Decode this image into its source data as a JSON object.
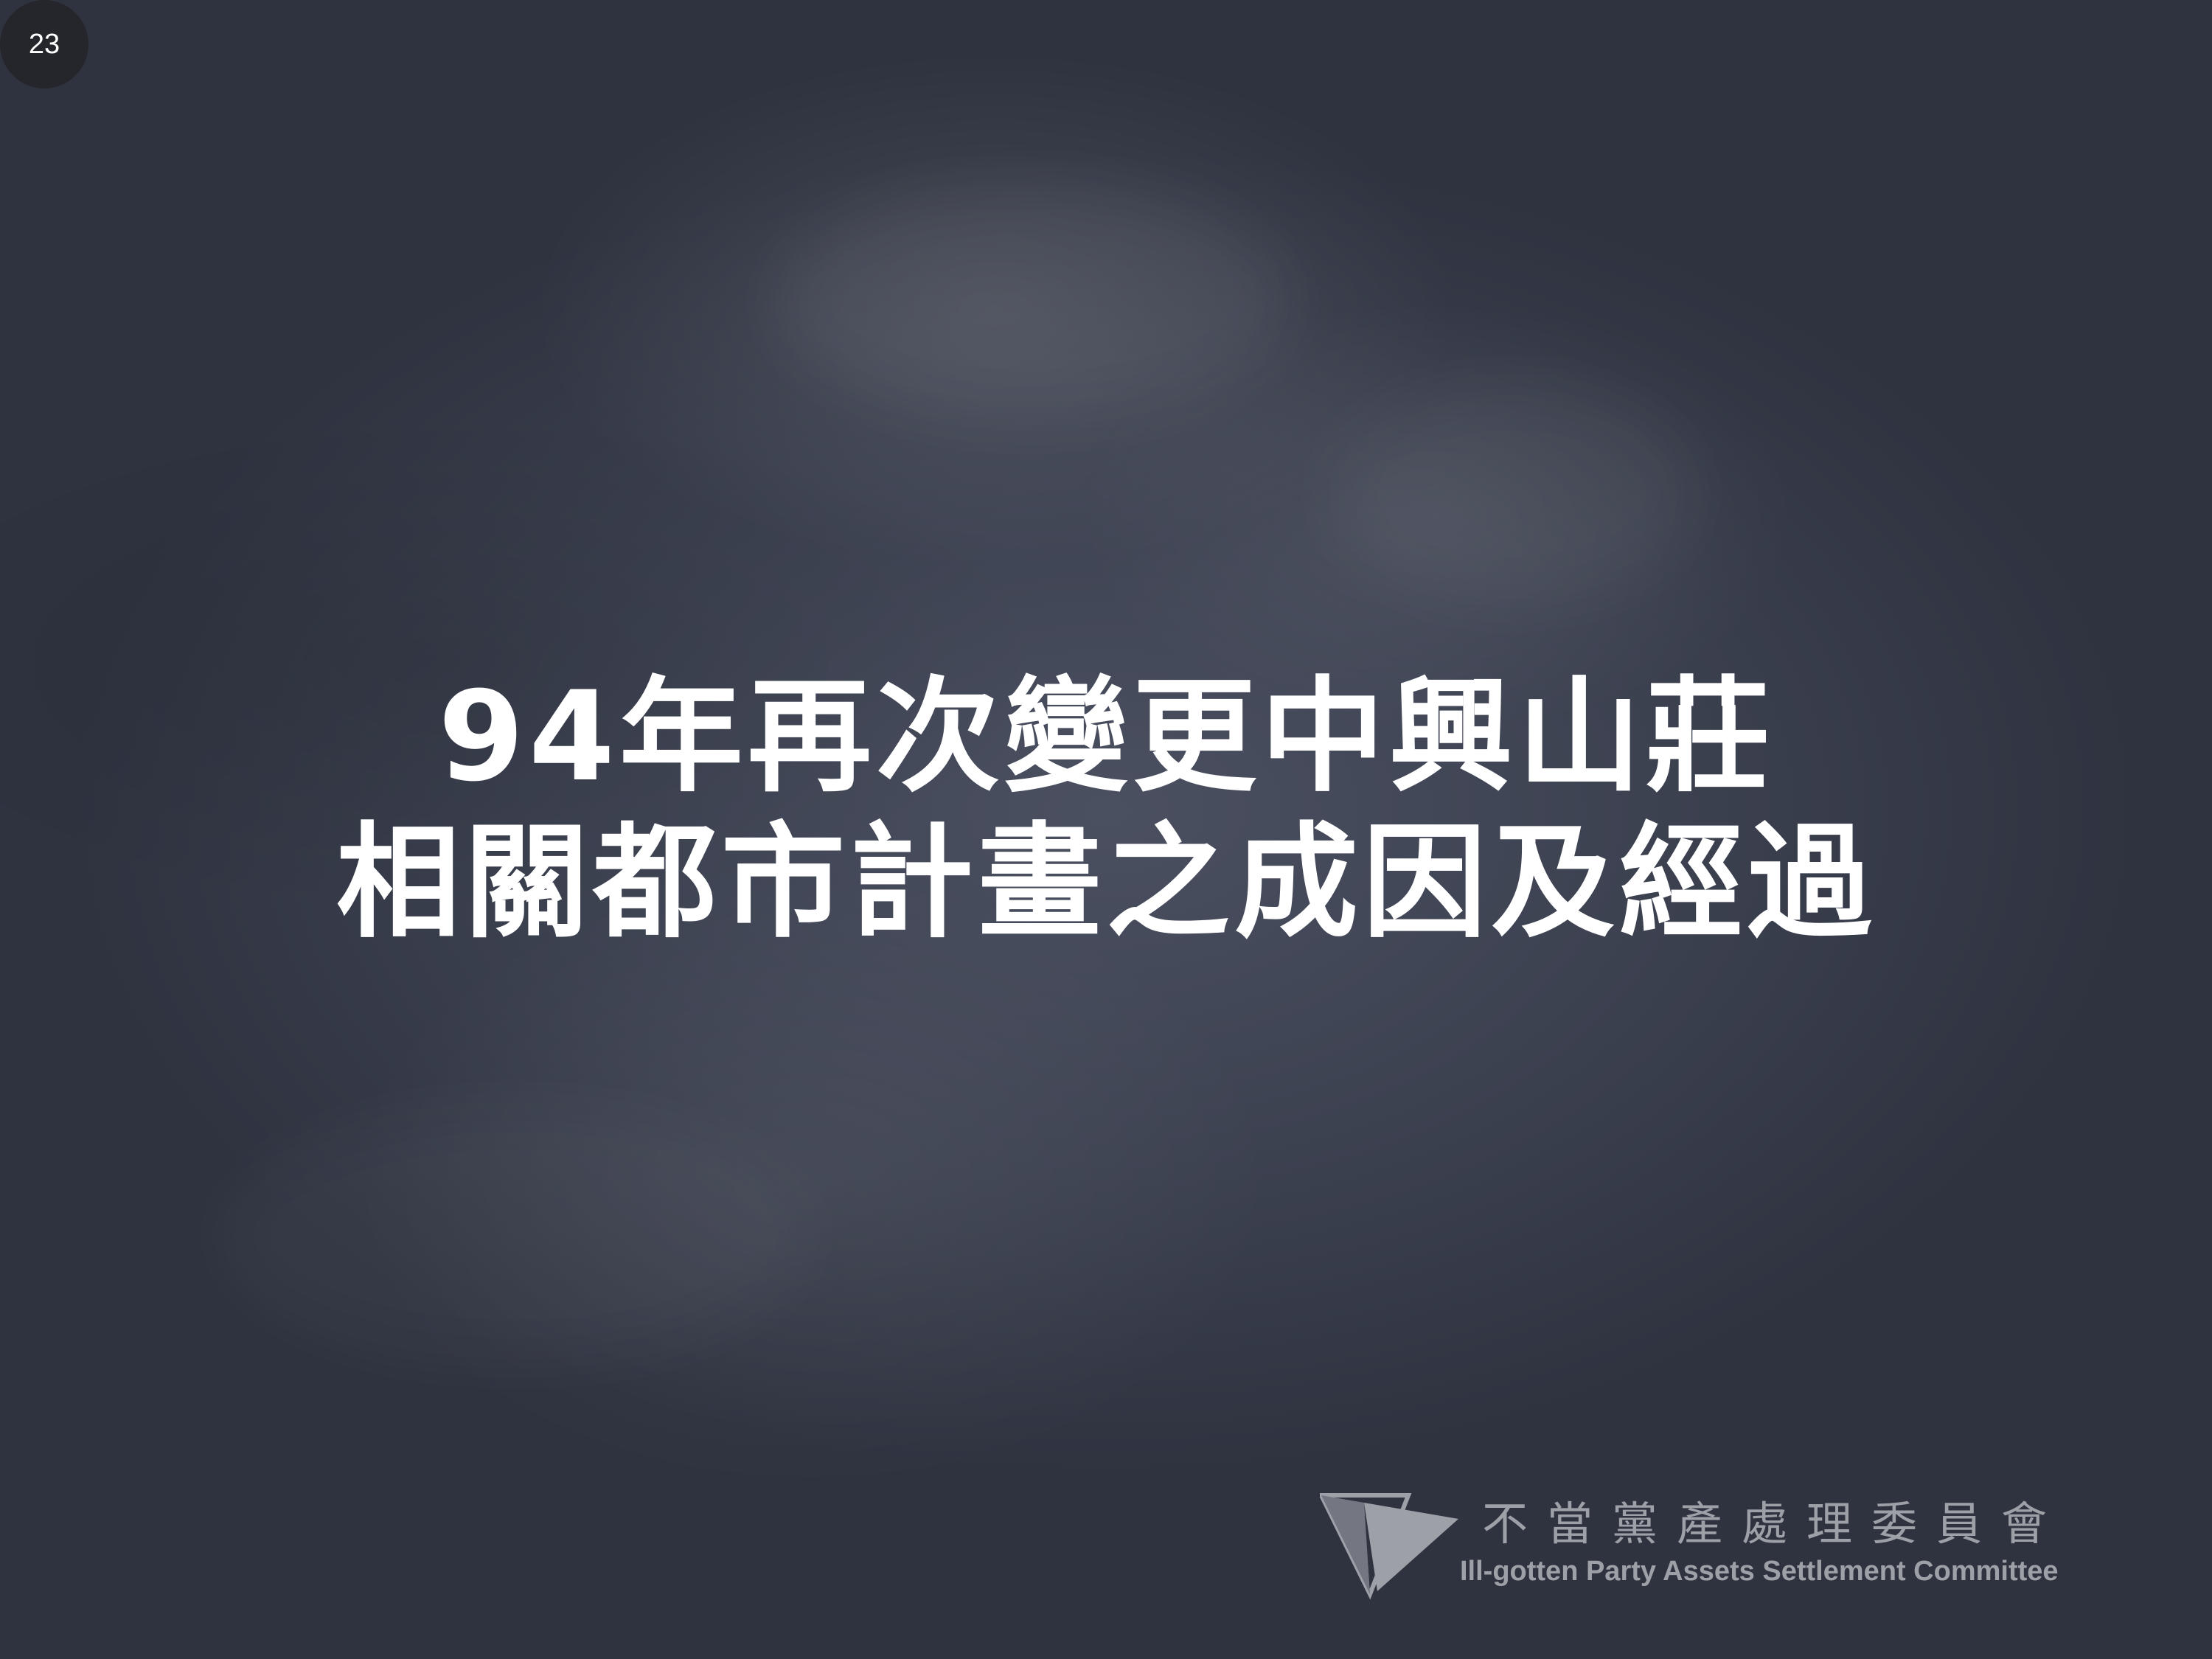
{
  "slide": {
    "page_number": "23",
    "title_lines": [
      "94年再次變更中興山莊",
      "相關都市計畫之成因及經過"
    ],
    "logo": {
      "icon": "triangle-logo-icon",
      "name_zh": "不當黨產處理委員會",
      "name_en": "Ill-gotten Party Assets Settlement Committee"
    }
  },
  "colors": {
    "background": "#3c4150",
    "title_text": "#ffffff",
    "badge_background": "#24262c",
    "logo_text": "#c9cbd0"
  }
}
